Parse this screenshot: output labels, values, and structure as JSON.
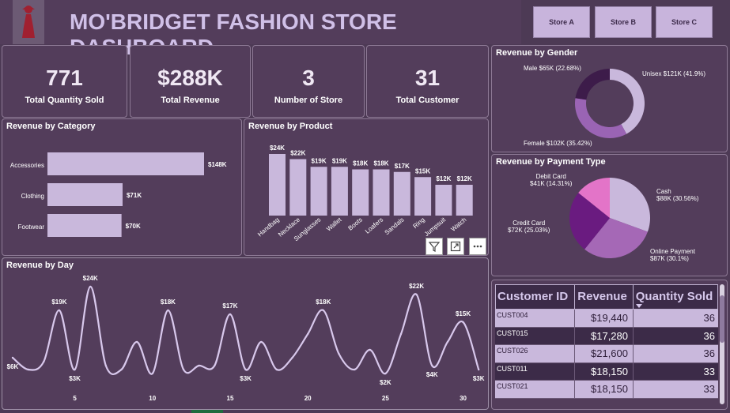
{
  "title": "MO'BRIDGET FASHION STORE DASHBOARD",
  "stores": [
    "Store A",
    "Store B",
    "Store C"
  ],
  "kpis": [
    {
      "value": "771",
      "label": "Total Quantity Sold"
    },
    {
      "value": "$288K",
      "label": "Total Revenue"
    },
    {
      "value": "3",
      "label": "Number of Store"
    },
    {
      "value": "31",
      "label": "Total Customer"
    }
  ],
  "gender": {
    "title": "Revenue by Gender",
    "labels": [
      "Male $65K (22.68%)",
      "Unisex $121K (41.9%)",
      "Female $102K (35.42%)"
    ]
  },
  "payment": {
    "title": "Revenue by Payment Type",
    "labels": {
      "debit": [
        "Debit Card",
        "$41K (14.31%)"
      ],
      "cash": [
        "Cash",
        "$88K (30.56%)"
      ],
      "credit": [
        "Credit Card",
        "$72K (25.03%)"
      ],
      "online": [
        "Online Payment",
        "$87K (30.1%)"
      ]
    }
  },
  "table": {
    "headers": [
      "Customer ID",
      "Revenue",
      "Quantity Sold"
    ],
    "rows": [
      [
        "CUST004",
        "$19,440",
        "36"
      ],
      [
        "CUST015",
        "$17,280",
        "36"
      ],
      [
        "CUST026",
        "$21,600",
        "36"
      ],
      [
        "CUST011",
        "$18,150",
        "33"
      ],
      [
        "CUST021",
        "$18,150",
        "33"
      ]
    ]
  },
  "toolbar_icons": [
    "filter-icon",
    "expand-icon",
    "more-options-icon"
  ],
  "chart_data": [
    {
      "type": "bar",
      "title": "Revenue by Category",
      "orientation": "horizontal",
      "categories": [
        "Accessories",
        "Clothing",
        "Footwear"
      ],
      "values": [
        148,
        71,
        70
      ],
      "labels": [
        "$148K",
        "$71K",
        "$70K"
      ],
      "unit": "K$",
      "color": "#c9b8dc"
    },
    {
      "type": "bar",
      "title": "Revenue by Product",
      "categories": [
        "Handbag",
        "Necklace",
        "Sunglasses",
        "Wallet",
        "Boots",
        "Loafers",
        "Sandals",
        "Ring",
        "Jumpsuit",
        "Watch"
      ],
      "values": [
        24,
        22,
        19,
        19,
        18,
        18,
        17,
        15,
        12,
        12
      ],
      "labels": [
        "$24K",
        "$22K",
        "$19K",
        "$19K",
        "$18K",
        "$18K",
        "$17K",
        "$15K",
        "$12K",
        "$12K"
      ],
      "color": "#c9b8dc"
    },
    {
      "type": "pie",
      "title": "Revenue by Gender",
      "donut": true,
      "categories": [
        "Unisex",
        "Female",
        "Male"
      ],
      "values": [
        121,
        102,
        65
      ],
      "percent": [
        41.9,
        35.42,
        22.68
      ],
      "colors": [
        "#c9b8dc",
        "#9a64b4",
        "#3d1c4a"
      ]
    },
    {
      "type": "pie",
      "title": "Revenue by Payment Type",
      "categories": [
        "Cash",
        "Online Payment",
        "Credit Card",
        "Debit Card"
      ],
      "values": [
        88,
        87,
        72,
        41
      ],
      "percent": [
        30.56,
        30.1,
        25.03,
        14.31
      ],
      "colors": [
        "#c9b8dc",
        "#a568b6",
        "#6a1b80",
        "#e374c8"
      ]
    },
    {
      "type": "line",
      "title": "Revenue by Day",
      "x": [
        1,
        2,
        3,
        4,
        5,
        6,
        7,
        8,
        9,
        10,
        11,
        12,
        13,
        14,
        15,
        16,
        17,
        18,
        19,
        20,
        21,
        22,
        23,
        24,
        25,
        26,
        27,
        28,
        29,
        30,
        31
      ],
      "y": [
        6,
        3,
        5,
        18,
        3,
        24,
        4,
        3,
        10,
        2,
        18,
        3,
        4,
        4,
        17,
        3,
        10,
        3,
        6,
        12,
        18,
        7,
        3,
        8,
        2,
        12,
        22,
        4,
        10,
        15,
        3
      ],
      "xticks": [
        5,
        10,
        15,
        20,
        25,
        30
      ],
      "point_labels": [
        {
          "x": 1,
          "text": "$6K"
        },
        {
          "x": 4,
          "text": "$19K"
        },
        {
          "x": 5,
          "text": "$3K"
        },
        {
          "x": 6,
          "text": "$24K"
        },
        {
          "x": 11,
          "text": "$18K"
        },
        {
          "x": 15,
          "text": "$17K"
        },
        {
          "x": 16,
          "text": "$3K"
        },
        {
          "x": 21,
          "text": "$18K"
        },
        {
          "x": 25,
          "text": "$2K"
        },
        {
          "x": 27,
          "text": "$22K"
        },
        {
          "x": 28,
          "text": "$4K"
        },
        {
          "x": 30,
          "text": "$15K"
        },
        {
          "x": 31,
          "text": "$3K"
        }
      ],
      "ylim": [
        0,
        26
      ],
      "color": "#d8c8ec"
    }
  ]
}
